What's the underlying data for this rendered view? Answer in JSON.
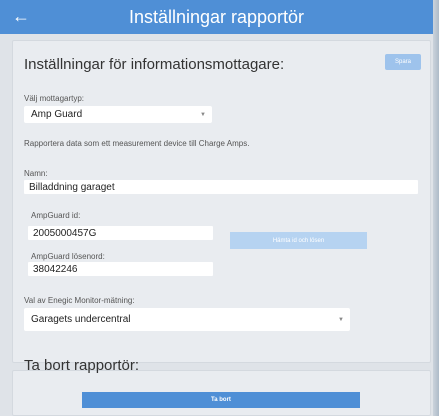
{
  "header": {
    "title": "Inställningar rapportör",
    "back_icon": "arrow-left-icon"
  },
  "recipient_settings": {
    "heading": "Inställningar för informationsmottagare:",
    "save_label": "Spara",
    "type_label": "Välj mottagartyp:",
    "type_value": "Amp Guard",
    "info": "Rapportera data som ett measurement device till Charge Amps.",
    "name_label": "Namn:",
    "name_value": "Billaddning garaget",
    "ampguard_id_label": "AmpGuard id:",
    "ampguard_id_value": "2005000457G",
    "fetch_label": "Hämta id och lösen",
    "ampguard_password_label": "AmpGuard lösenord:",
    "ampguard_password_value": "38042246",
    "monitor_label": "Val av Enegic Monitor-mätning:",
    "monitor_value": "Garagets undercentral"
  },
  "remove_reporter": {
    "heading": "Ta bort rapportör:",
    "delete_label": "Ta bort"
  },
  "colors": {
    "accent": "#4f8fd6",
    "save_button": "#9ec3ec",
    "fetch_button": "#b6d3f1",
    "background": "#dfe3e8",
    "card": "#e9ecf0"
  }
}
